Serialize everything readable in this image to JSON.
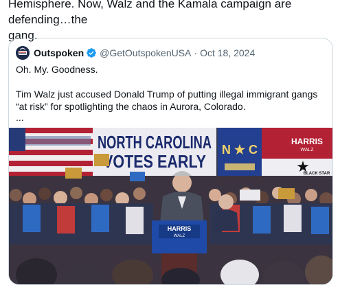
{
  "post": {
    "text_line1": "Hemisphere. Now, Walz and the Kamala campaign are defending…the",
    "text_line2": "gang."
  },
  "quote": {
    "author_name": "Outspoken",
    "handle": "@GetOutspokenUSA",
    "separator": "·",
    "date": "Oct 18, 2024",
    "line1": "Oh. My. Goodness.",
    "line2": "Tim Walz just accused Donald Trump of putting illegal immigrant gangs “at risk” for spotlighting the chaos in Aurora, Colorado.",
    "line3": "..."
  },
  "media": {
    "banner_line1": "NORTH CAROLINA",
    "banner_line2": "VOTES EARLY",
    "flag_text": "N ★ C",
    "right_sign": "HARRIS",
    "right_sign_sub": "WALZ",
    "black_star": "BLACK STAR",
    "podium_line1": "HARRIS",
    "podium_line2": "WALZ",
    "colors": {
      "banner_red": "#b32134",
      "banner_blue": "#1a2a6c",
      "nc_blue": "#233f8f",
      "crowd": "#3b3440"
    }
  },
  "icons": {
    "avatar": "outspoken-logo-icon",
    "verified": "verified-badge-icon"
  }
}
